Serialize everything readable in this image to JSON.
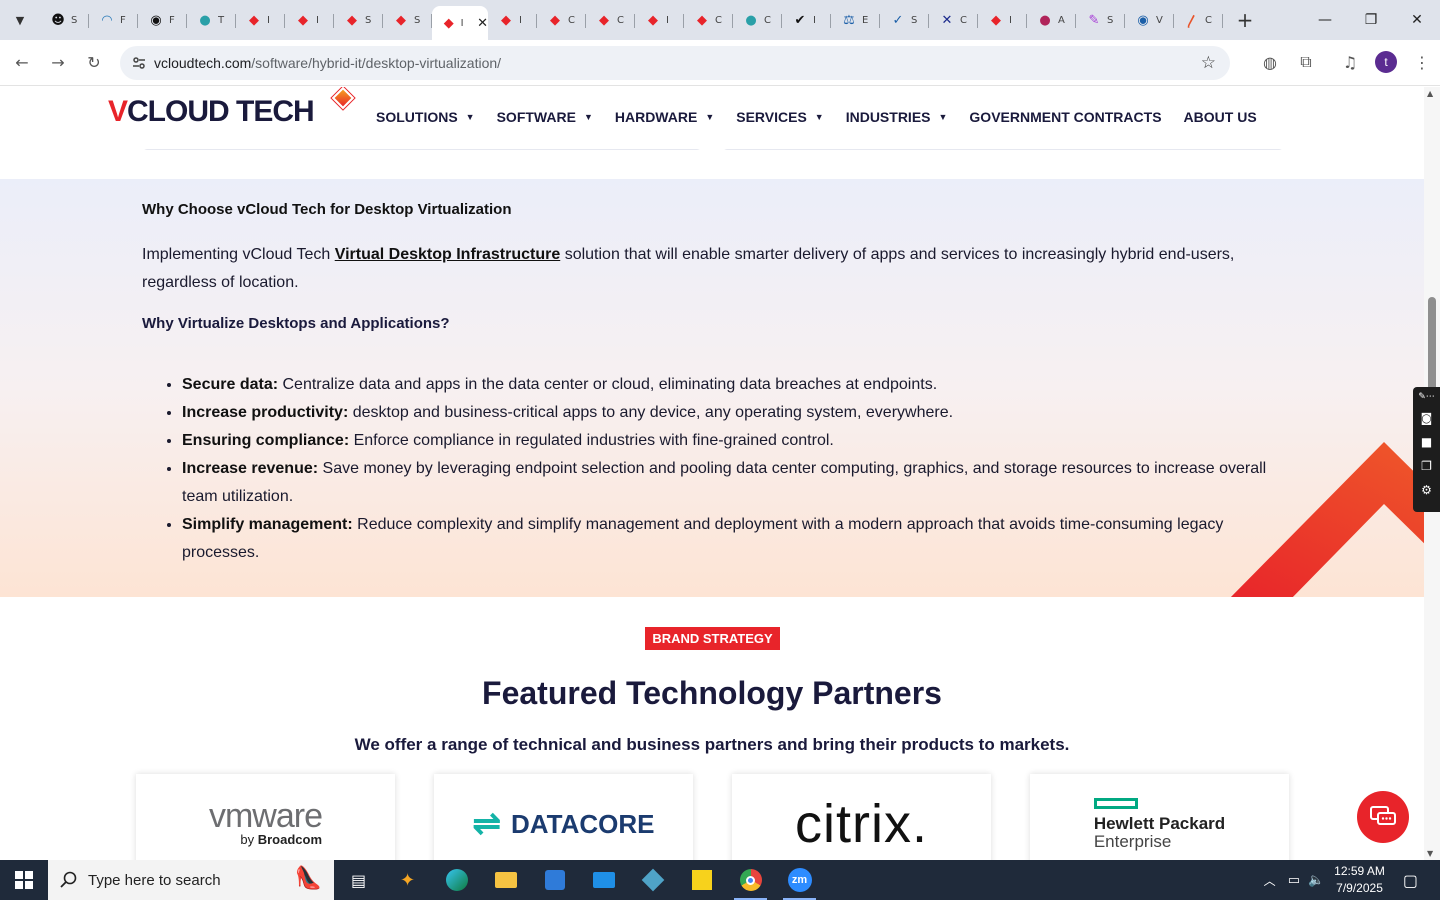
{
  "browser": {
    "tabs": [
      {
        "name": "S",
        "color": "#111111",
        "glyph": "☻"
      },
      {
        "name": "F",
        "color": "#2a7ab8",
        "glyph": "◠"
      },
      {
        "name": "F",
        "color": "#111111",
        "glyph": "◉"
      },
      {
        "name": "T",
        "color": "#2aa0a8",
        "glyph": "●"
      },
      {
        "name": "I",
        "color": "#e8242a",
        "glyph": "◆"
      },
      {
        "name": "I",
        "color": "#e8242a",
        "glyph": "◆"
      },
      {
        "name": "S",
        "color": "#e8242a",
        "glyph": "◆"
      },
      {
        "name": "S",
        "color": "#e8242a",
        "glyph": "◆"
      }
    ],
    "active_tab": {
      "name": "I",
      "color": "#e8242a",
      "glyph": "◆"
    },
    "tabs_after": [
      {
        "name": "I",
        "color": "#e8242a",
        "glyph": "◆"
      },
      {
        "name": "C",
        "color": "#e8242a",
        "glyph": "◆"
      },
      {
        "name": "C",
        "color": "#e8242a",
        "glyph": "◆"
      },
      {
        "name": "I",
        "color": "#e8242a",
        "glyph": "◆"
      },
      {
        "name": "C",
        "color": "#e8242a",
        "glyph": "◆"
      },
      {
        "name": "C",
        "color": "#2aa0a8",
        "glyph": "●"
      },
      {
        "name": "I",
        "color": "#111111",
        "glyph": "✔"
      },
      {
        "name": "E",
        "color": "#1b5fa8",
        "glyph": "⚖"
      },
      {
        "name": "S",
        "color": "#1b5fa8",
        "glyph": "✓"
      },
      {
        "name": "C",
        "color": "#1b2a8c",
        "glyph": "✕"
      },
      {
        "name": "I",
        "color": "#e8242a",
        "glyph": "◆"
      },
      {
        "name": "A",
        "color": "#b0245a",
        "glyph": "●"
      },
      {
        "name": "S",
        "color": "#a63bd6",
        "glyph": "✎"
      },
      {
        "name": "V",
        "color": "#1b5fa8",
        "glyph": "◉"
      },
      {
        "name": "C",
        "color": "#e8542a",
        "glyph": "〳"
      }
    ],
    "url_host": "vcloudtech.com",
    "url_path": "/software/hybrid-it/desktop-virtualization/",
    "profile_initial": "t"
  },
  "site": {
    "logo_v": "V",
    "logo_rest": "CLOUD TECH",
    "nav": [
      {
        "label": "SOLUTIONS",
        "caret": true
      },
      {
        "label": "SOFTWARE",
        "caret": true
      },
      {
        "label": "HARDWARE",
        "caret": true
      },
      {
        "label": "SERVICES",
        "caret": true
      },
      {
        "label": "INDUSTRIES",
        "caret": true
      },
      {
        "label": "GOVERNMENT CONTRACTS",
        "caret": false
      },
      {
        "label": "ABOUT US",
        "caret": false
      }
    ]
  },
  "why": {
    "title": "Why Choose vCloud Tech for Desktop Virtualization",
    "intro_before": "Implementing vCloud Tech ",
    "intro_link": "Virtual Desktop Infrastructure",
    "intro_after": " solution that will enable smarter delivery of apps and services to increasingly hybrid end-users, regardless of location.",
    "subtitle": "Why Virtualize Desktops and Applications?",
    "benefits": [
      {
        "label": "Secure data:",
        "text": " Centralize data and apps in the data center or cloud, eliminating data breaches at endpoints."
      },
      {
        "label": "Increase productivity:",
        "text": " desktop and business-critical apps to any device, any operating system, everywhere."
      },
      {
        "label": "Ensuring compliance:",
        "text": " Enforce compliance in regulated industries with fine-grained control."
      },
      {
        "label": "Increase revenue:",
        "text": " Save money by leveraging endpoint selection and pooling data center computing, graphics, and storage resources to increase overall team utilization."
      },
      {
        "label": "Simplify management:",
        "text": " Reduce complexity and simplify management and deployment with a modern approach that avoids time-consuming legacy processes."
      }
    ]
  },
  "partners": {
    "badge": "BRAND STRATEGY",
    "title": "Featured Technology Partners",
    "subtitle": "We offer a range of technical and business partners and bring their products to markets.",
    "vmware": "vmware",
    "vmware_by": "by ",
    "vmware_broadcom": "Broadcom",
    "datacore": "DATACORE",
    "citrix": "citrix.",
    "hpe_line1": "Hewlett Packard",
    "hpe_line2": "Enterprise"
  },
  "taskbar": {
    "search_placeholder": "Type here to search",
    "time": "12:59 AM",
    "date": "7/9/2025"
  },
  "colors": {
    "brand_red": "#e8242a",
    "brand_navy": "#1a1a3c"
  }
}
